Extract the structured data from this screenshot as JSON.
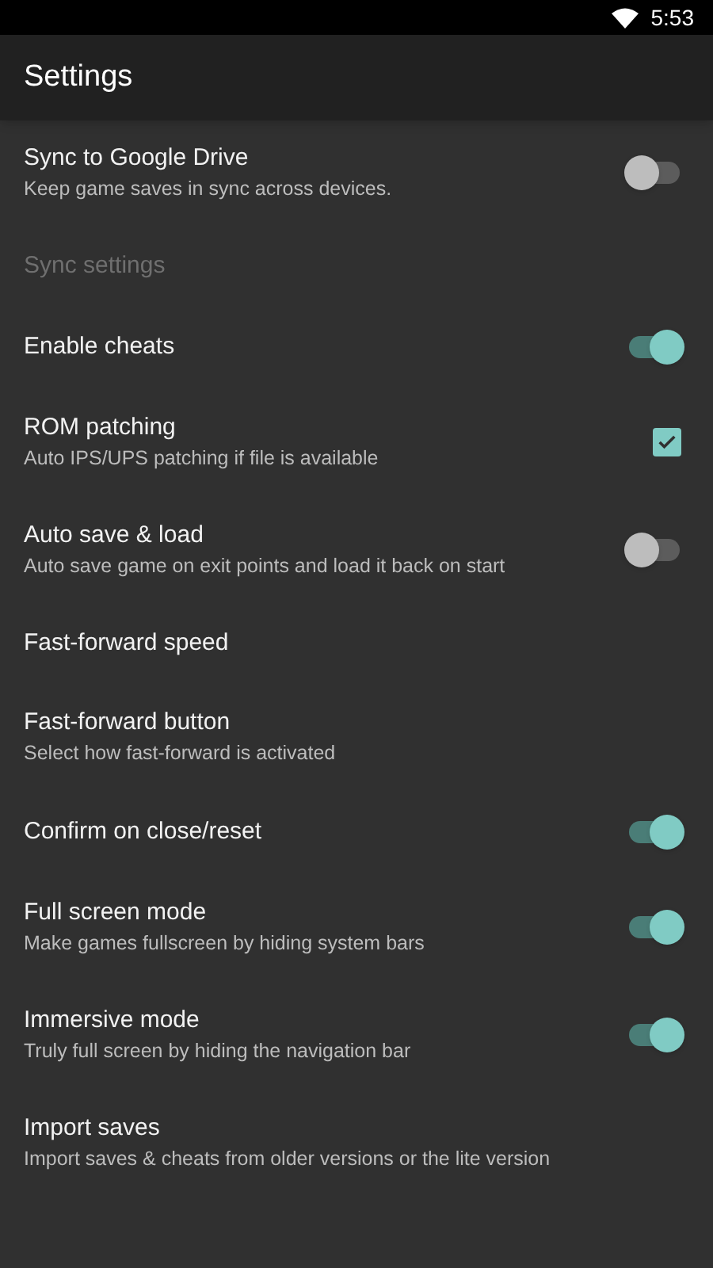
{
  "status_bar": {
    "time": "5:53"
  },
  "toolbar": {
    "title": "Settings"
  },
  "items": [
    {
      "kind": "switch",
      "title": "Sync to Google Drive",
      "summary": "Keep game saves in sync across devices.",
      "on": false
    },
    {
      "kind": "header",
      "title": "Sync settings"
    },
    {
      "kind": "switch",
      "title": "Enable cheats",
      "on": true
    },
    {
      "kind": "checkbox",
      "title": "ROM patching",
      "summary": "Auto IPS/UPS patching if file is available",
      "checked": true
    },
    {
      "kind": "switch",
      "title": "Auto save & load",
      "summary": "Auto save game on exit points and load it back on start",
      "on": false
    },
    {
      "kind": "plain",
      "title": "Fast-forward speed"
    },
    {
      "kind": "plain",
      "title": "Fast-forward button",
      "summary": "Select how fast-forward is activated"
    },
    {
      "kind": "switch",
      "title": "Confirm on close/reset",
      "on": true
    },
    {
      "kind": "switch",
      "title": "Full screen mode",
      "summary": "Make games fullscreen by hiding system bars",
      "on": true
    },
    {
      "kind": "switch",
      "title": "Immersive mode",
      "summary": "Truly full screen by hiding the navigation bar",
      "on": true
    },
    {
      "kind": "plain",
      "title": "Import saves",
      "summary": "Import saves & cheats from older versions or the lite version"
    }
  ]
}
